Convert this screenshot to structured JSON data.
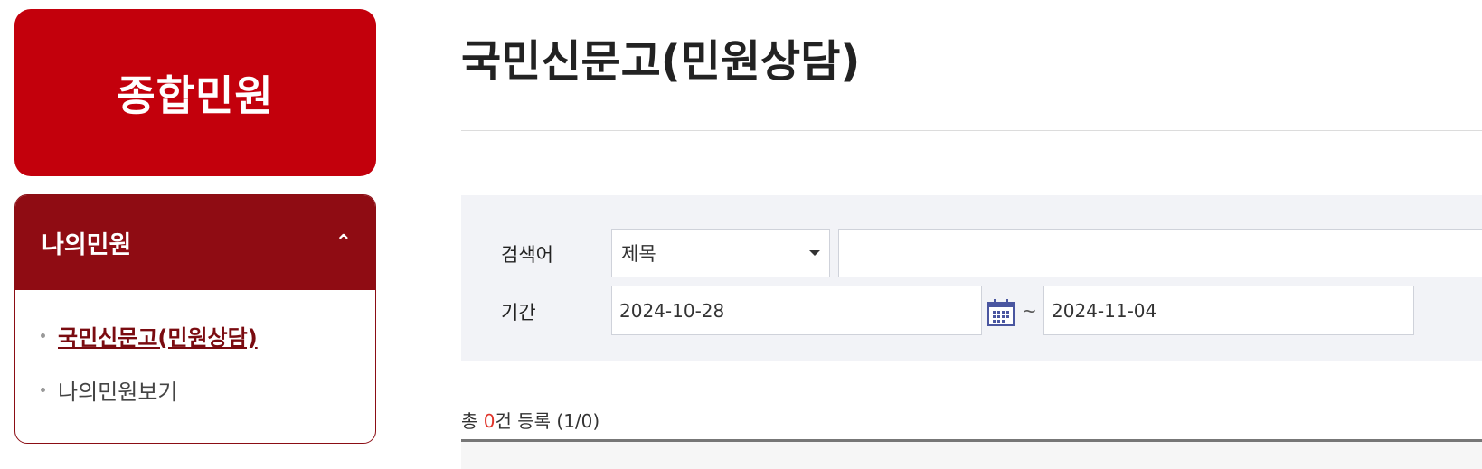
{
  "sidebar": {
    "title": "종합민원",
    "section": {
      "label": "나의민원",
      "toggle_icon": "chevron-up-icon",
      "items": [
        {
          "label": "국민신문고(민원상담)",
          "active": true
        },
        {
          "label": "나의민원보기",
          "active": false
        }
      ]
    }
  },
  "main": {
    "title": "국민신문고(민원상담)",
    "search": {
      "keyword_label": "검색어",
      "field_select": "제목",
      "keyword_value": "",
      "period_label": "기간",
      "date_from": "2024-10-28",
      "date_to": "2024-11-04",
      "separator": "~",
      "calendar_icon": "calendar-icon"
    },
    "summary": {
      "prefix": "총 ",
      "count": "0",
      "suffix": "건 등록",
      "pages": " (1/0)"
    }
  },
  "colors": {
    "brand_red": "#c3000c",
    "dark_red": "#8f0c13",
    "panel_bg": "#f2f3f7",
    "count_red": "#e0342a"
  }
}
